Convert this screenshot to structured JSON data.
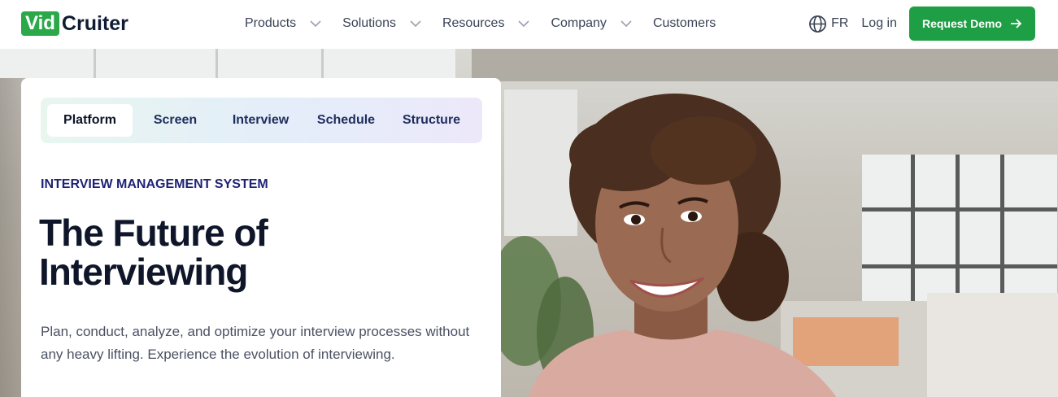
{
  "logo": {
    "part1": "Vid",
    "part2": "Cruiter"
  },
  "nav": {
    "items": [
      {
        "label": "Products"
      },
      {
        "label": "Solutions"
      },
      {
        "label": "Resources"
      },
      {
        "label": "Company"
      },
      {
        "label": "Customers"
      }
    ],
    "language": "FR",
    "login": "Log in",
    "demo_button": "Request Demo"
  },
  "hero": {
    "tabs": [
      {
        "label": "Platform",
        "active": true
      },
      {
        "label": "Screen"
      },
      {
        "label": "Interview"
      },
      {
        "label": "Schedule"
      },
      {
        "label": "Structure"
      }
    ],
    "eyebrow": "INTERVIEW MANAGEMENT SYSTEM",
    "headline_line1": "The Future of",
    "headline_line2": "Interviewing",
    "description": "Plan, conduct, analyze, and optimize your interview processes without any heavy lifting. Experience the evolution of interviewing."
  },
  "colors": {
    "brand_green": "#1e9e45",
    "logo_green": "#2aa84a",
    "navy": "#1f2377",
    "headline": "#0f1629"
  },
  "icons": {
    "language": "globe-icon",
    "caret": "chevron-down-icon",
    "demo_arrow": "arrow-right-icon"
  }
}
